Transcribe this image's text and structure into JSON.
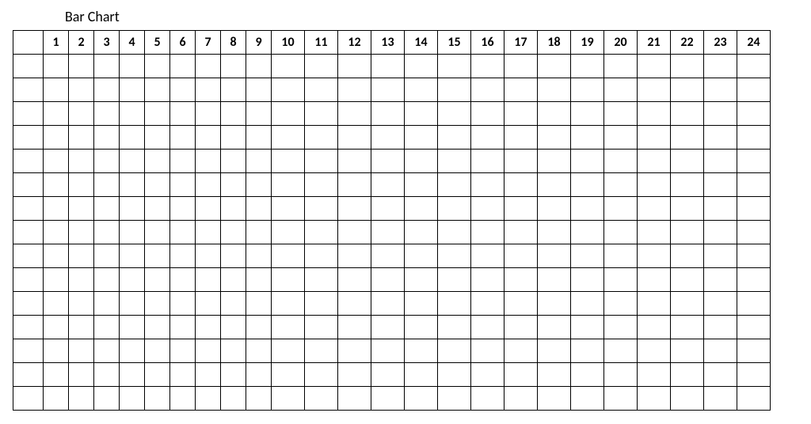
{
  "chart_data": {
    "type": "bar",
    "title": "Bar Chart",
    "categories": [
      "1",
      "2",
      "3",
      "4",
      "5",
      "6",
      "7",
      "8",
      "9",
      "10",
      "11",
      "12",
      "13",
      "14",
      "15",
      "16",
      "17",
      "18",
      "19",
      "20",
      "21",
      "22",
      "23",
      "24"
    ],
    "values": [],
    "xlabel": "",
    "ylabel": "",
    "ylim": [
      0,
      15
    ],
    "grid_rows": 15,
    "grid_cols": 25
  }
}
